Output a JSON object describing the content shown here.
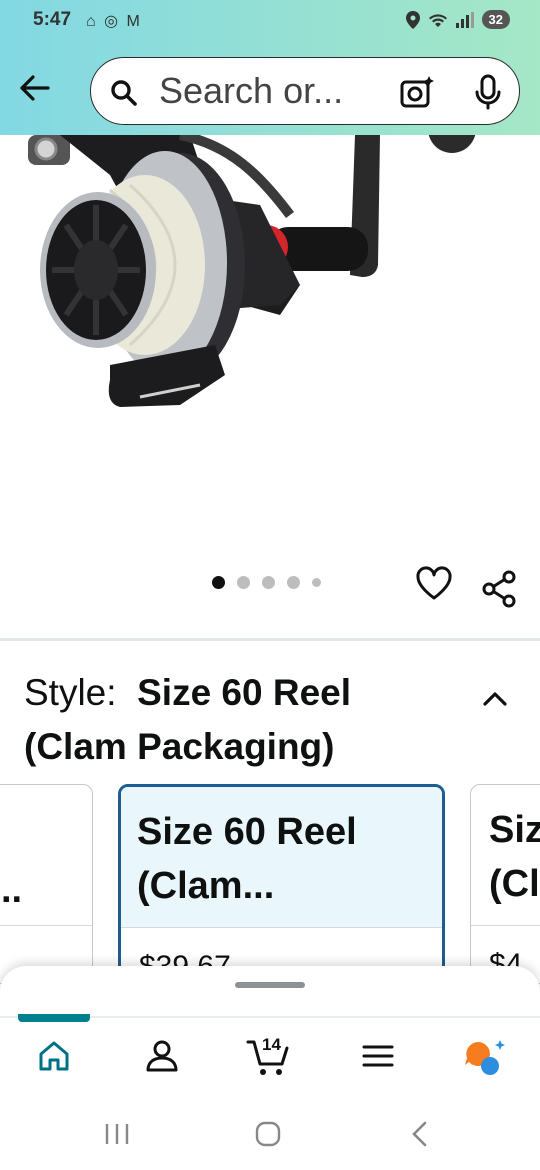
{
  "status_bar": {
    "time": "5:47",
    "battery": "32"
  },
  "search": {
    "placeholder": "Search or..."
  },
  "gallery": {
    "dot_count": 5,
    "active_index": 0
  },
  "style_selector": {
    "label": "Style:",
    "value": "Size 60 Reel (Clam Packaging)",
    "options": [
      {
        "title": "..",
        "price": ""
      },
      {
        "title": "Size 60 Reel (Clam...",
        "price": "$39.67"
      },
      {
        "title": "Siz (Cl",
        "price": "$4"
      }
    ]
  },
  "bottom_nav": {
    "cart_count": "14",
    "items": [
      "home",
      "account",
      "cart",
      "menu",
      "rufus"
    ]
  },
  "colors": {
    "header_gradient_start": "#82d8e3",
    "header_gradient_end": "#a5e7c6",
    "selected_border": "#1d5d90",
    "active_tab": "#00808f"
  }
}
